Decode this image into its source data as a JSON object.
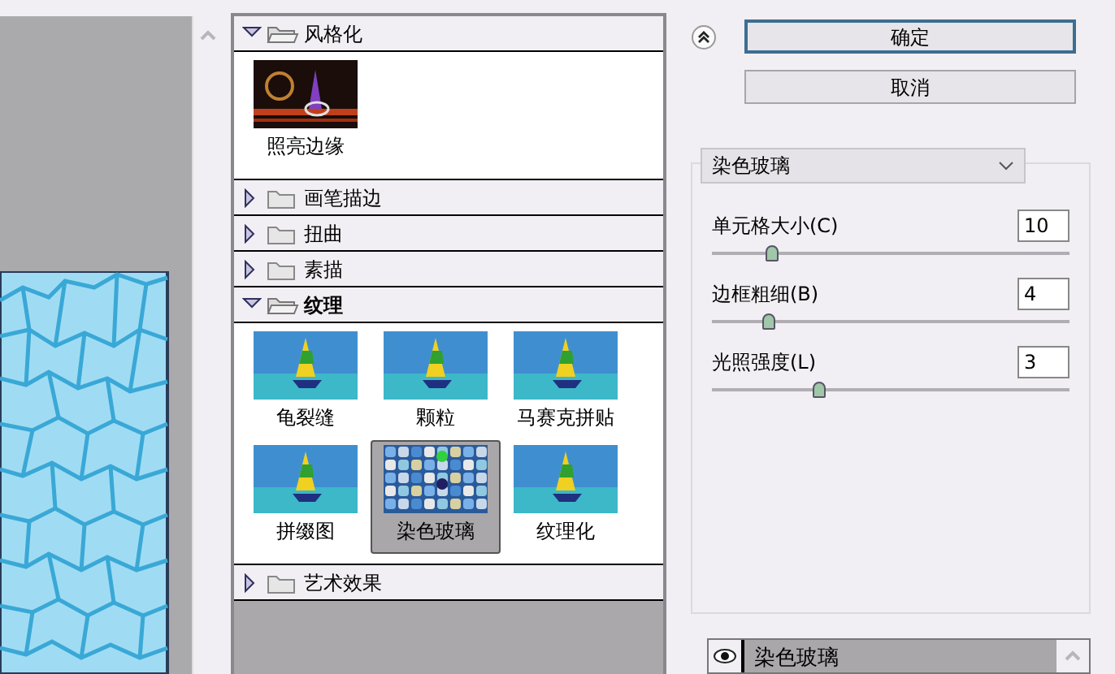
{
  "folders": [
    {
      "name": "风格化",
      "expanded": true,
      "filters": [
        {
          "name": "照亮边缘",
          "selected": false
        }
      ]
    },
    {
      "name": "画笔描边",
      "expanded": false
    },
    {
      "name": "扭曲",
      "expanded": false
    },
    {
      "name": "素描",
      "expanded": false
    },
    {
      "name": "纹理",
      "expanded": true,
      "filters": [
        {
          "name": "龟裂缝",
          "selected": false
        },
        {
          "name": "颗粒",
          "selected": false
        },
        {
          "name": "马赛克拼贴",
          "selected": false
        },
        {
          "name": "拼缀图",
          "selected": false
        },
        {
          "name": "染色玻璃",
          "selected": true
        },
        {
          "name": "纹理化",
          "selected": false
        }
      ]
    },
    {
      "name": "艺术效果",
      "expanded": false
    }
  ],
  "buttons": [
    {
      "label": "确定",
      "default": true
    },
    {
      "label": "取消",
      "default": false
    }
  ],
  "filter_select": {
    "value": "染色玻璃"
  },
  "params": [
    {
      "label": "单元格大小(C)",
      "value": "10",
      "level": 0.17
    },
    {
      "label": "边框粗细(B)",
      "value": "4",
      "level": 0.16
    },
    {
      "label": "光照强度(L)",
      "value": "3",
      "level": 0.3
    }
  ],
  "layers": [
    {
      "name": "染色玻璃",
      "visible": true,
      "selected": true
    }
  ]
}
